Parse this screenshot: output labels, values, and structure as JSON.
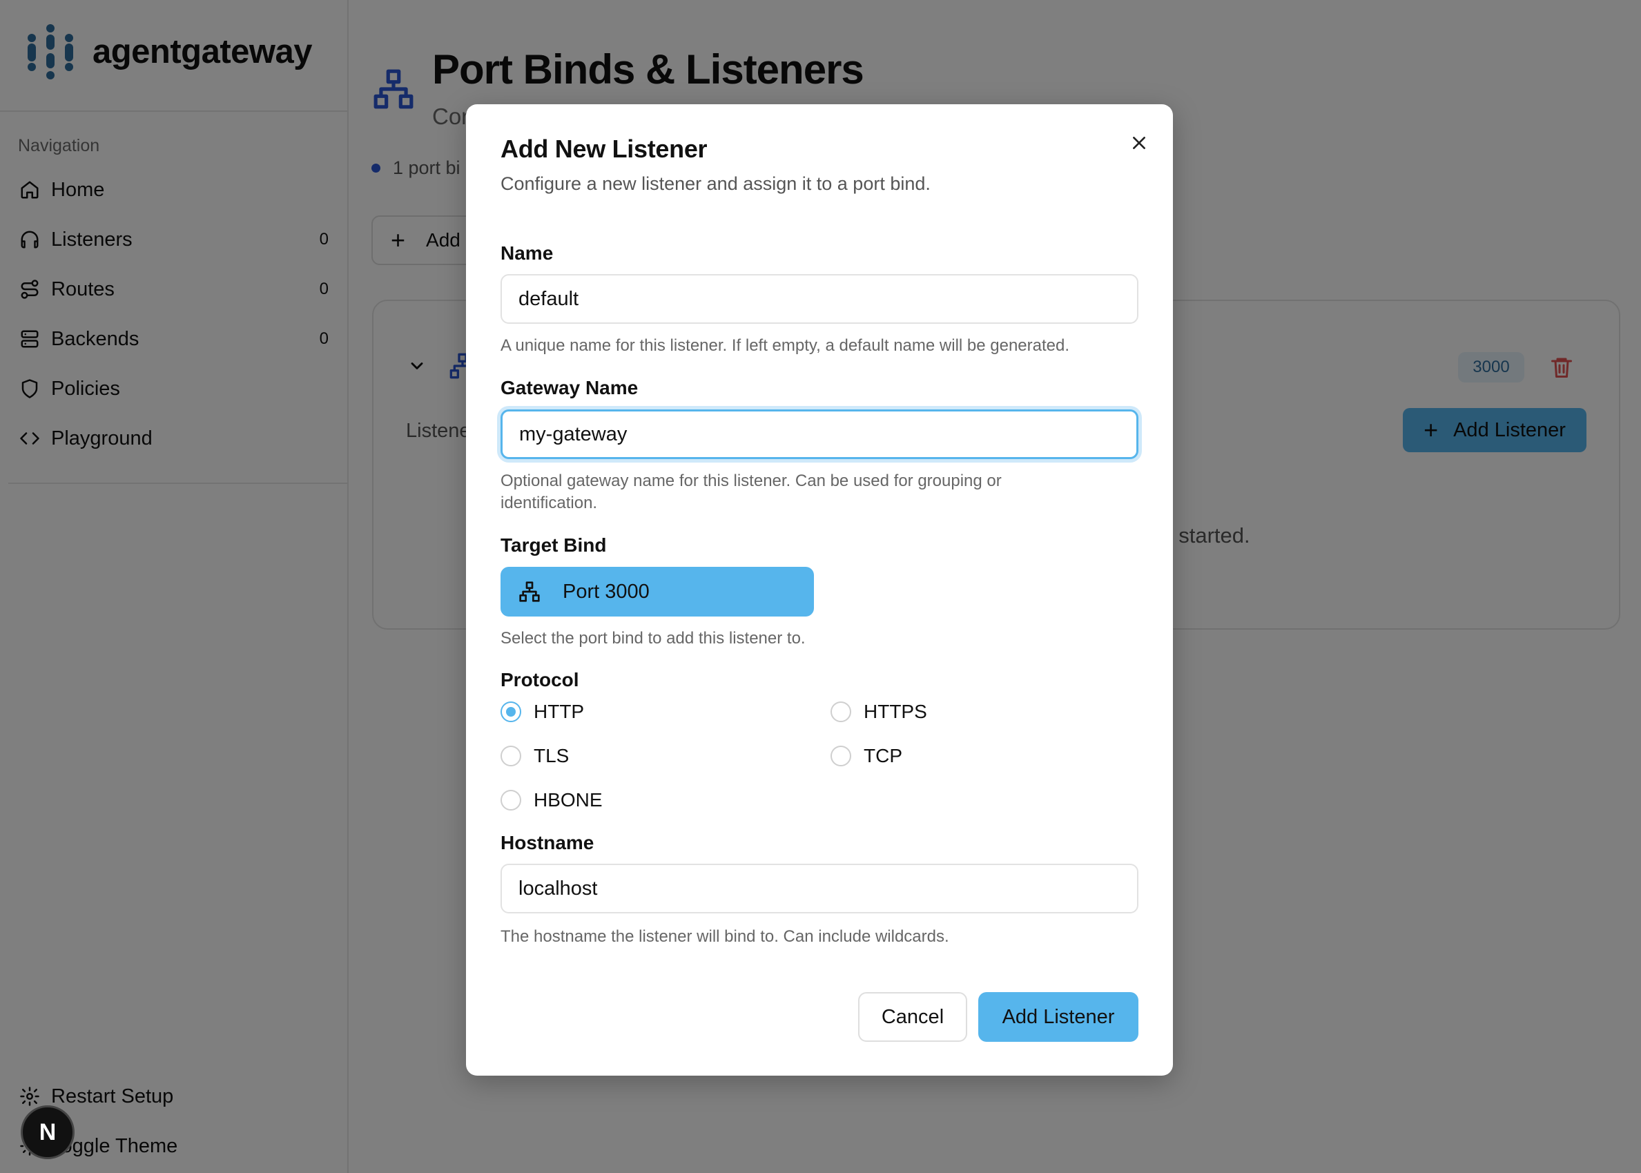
{
  "app": {
    "name": "agentgateway"
  },
  "sidebar": {
    "nav_title": "Navigation",
    "items": [
      {
        "label": "Home",
        "icon": "home-icon",
        "count": ""
      },
      {
        "label": "Listeners",
        "icon": "headphones-icon",
        "count": "0"
      },
      {
        "label": "Routes",
        "icon": "route-icon",
        "count": "0"
      },
      {
        "label": "Backends",
        "icon": "server-icon",
        "count": "0"
      },
      {
        "label": "Policies",
        "icon": "shield-icon",
        "count": ""
      },
      {
        "label": "Playground",
        "icon": "code-icon",
        "count": ""
      }
    ],
    "bottom": {
      "restart_label": "Restart Setup",
      "theme_label": "Toggle Theme"
    },
    "dev_badge": "N"
  },
  "main": {
    "title": "Port Binds & Listeners",
    "subtitle_visible": "Cor",
    "status_visible": "1 port bi",
    "add_button_visible": "Add",
    "card": {
      "port_badge": "3000",
      "add_listener_label": "Add Listener",
      "listeners_label_visible": "Listene",
      "empty_text_visible": "t started."
    }
  },
  "modal": {
    "title": "Add New Listener",
    "description": "Configure a new listener and assign it to a port bind.",
    "name": {
      "label": "Name",
      "value": "default",
      "help": "A unique name for this listener. If left empty, a default name will be generated."
    },
    "gateway": {
      "label": "Gateway Name",
      "value": "my-gateway",
      "help_line1": "Optional gateway name for this listener. Can be used for grouping or",
      "help_line2": "identification."
    },
    "target_bind": {
      "label": "Target Bind",
      "selected": "Port 3000",
      "help": "Select the port bind to add this listener to."
    },
    "protocol": {
      "label": "Protocol",
      "options": [
        "HTTP",
        "HTTPS",
        "TLS",
        "TCP",
        "HBONE"
      ],
      "selected": "HTTP"
    },
    "hostname": {
      "label": "Hostname",
      "value": "localhost",
      "help": "The hostname the listener will bind to. Can include wildcards."
    },
    "cancel_label": "Cancel",
    "submit_label": "Add Listener"
  },
  "colors": {
    "accent": "#56b5ec",
    "status_dot": "#2b56d4",
    "logo": "#2f6d9c",
    "danger": "#e05252"
  }
}
